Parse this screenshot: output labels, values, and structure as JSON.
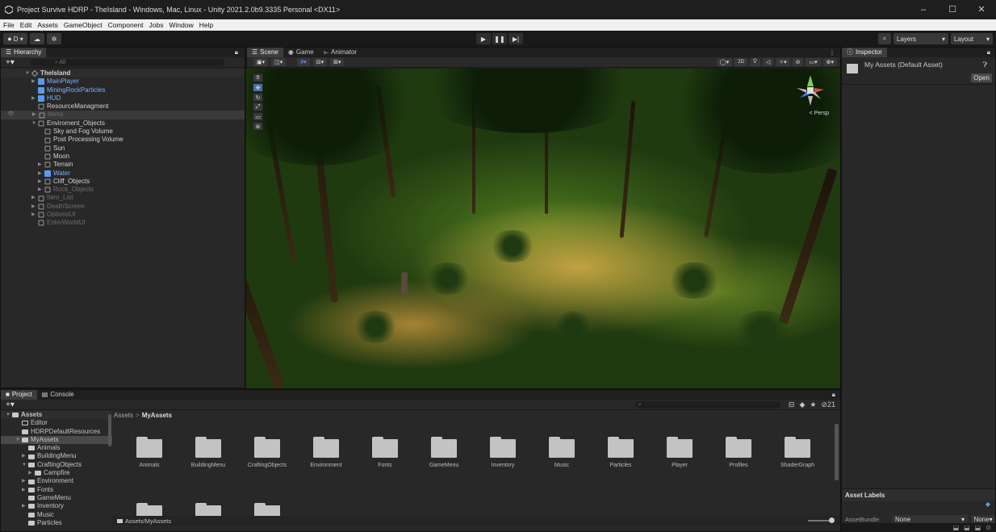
{
  "window": {
    "title": "Project Survive HDRP - TheIsland - Windows, Mac, Linux - Unity 2021.2.0b9.3335 Personal <DX11>",
    "controls": [
      "–",
      "☐",
      "✕"
    ]
  },
  "menu": [
    "File",
    "Edit",
    "Assets",
    "GameObject",
    "Component",
    "Jobs",
    "Window",
    "Help"
  ],
  "toolbar": {
    "account": "D ▾",
    "layers": "Layers",
    "layout": "Layout"
  },
  "hierarchy": {
    "tab": "Hierarchy",
    "search_placeholder": "All",
    "scene": "TheIsland",
    "items": [
      {
        "label": "MainPlayer",
        "style": "blue"
      },
      {
        "label": "MiningRockParticles",
        "style": "blue"
      },
      {
        "label": "HUD",
        "style": "blue"
      },
      {
        "label": "ResourceManagment",
        "style": "normal"
      },
      {
        "label": "Items",
        "style": "dim"
      },
      {
        "label": "Enviroment_Objects",
        "style": "normal"
      },
      {
        "label": "Sky and Fog Volume",
        "style": "normal"
      },
      {
        "label": "Post Processing Volume",
        "style": "normal"
      },
      {
        "label": "Sun",
        "style": "normal"
      },
      {
        "label": "Moon",
        "style": "normal"
      },
      {
        "label": "Terrain",
        "style": "normal"
      },
      {
        "label": "Water",
        "style": "blue"
      },
      {
        "label": "Cliff_Objects",
        "style": "normal"
      },
      {
        "label": "Rock_Objects",
        "style": "dim"
      },
      {
        "label": "Item_List",
        "style": "dim"
      },
      {
        "label": "DeathScreen",
        "style": "dim"
      },
      {
        "label": "OptionsUI",
        "style": "dim"
      },
      {
        "label": "EnterWorldUI",
        "style": "dim"
      }
    ]
  },
  "scene_tabs": {
    "scene": "Scene",
    "game": "Game",
    "animator": "Animator",
    "mode_2d": "2D",
    "persp": "< Persp"
  },
  "inspector": {
    "tab": "Inspector",
    "asset_title": "My Assets (Default Asset)",
    "open_button": "Open",
    "asset_labels": "Asset Labels",
    "assetbundle_label": "AssetBundle",
    "assetbundle_value": "None",
    "variant_value": "None"
  },
  "project": {
    "tab_project": "Project",
    "tab_console": "Console",
    "badge_count": "21",
    "breadcrumb_root": "Assets",
    "breadcrumb_sep": ">",
    "breadcrumb_current": "MyAssets",
    "footer_path": "Assets/MyAssets",
    "tree": [
      {
        "label": "Assets",
        "level": 0,
        "bold": true
      },
      {
        "label": "Editor",
        "level": 1
      },
      {
        "label": "HDRPDefaultResources",
        "level": 1
      },
      {
        "label": "MyAssets",
        "level": 1,
        "selected": true
      },
      {
        "label": "Animals",
        "level": 2
      },
      {
        "label": "BuildingMenu",
        "level": 2
      },
      {
        "label": "CraftingObjects",
        "level": 2
      },
      {
        "label": "Campfire",
        "level": 3
      },
      {
        "label": "Environment",
        "level": 2
      },
      {
        "label": "Fonts",
        "level": 2
      },
      {
        "label": "GameMenu",
        "level": 2
      },
      {
        "label": "Inventory",
        "level": 2
      },
      {
        "label": "Music",
        "level": 2
      },
      {
        "label": "Particles",
        "level": 2
      }
    ],
    "folders": [
      "Animals",
      "BuildingMenu",
      "CraftingObjects",
      "Environment",
      "Fonts",
      "GameMenu",
      "Inventory",
      "Music",
      "Particles",
      "Player",
      "Profiles",
      "ShaderGraph"
    ]
  }
}
